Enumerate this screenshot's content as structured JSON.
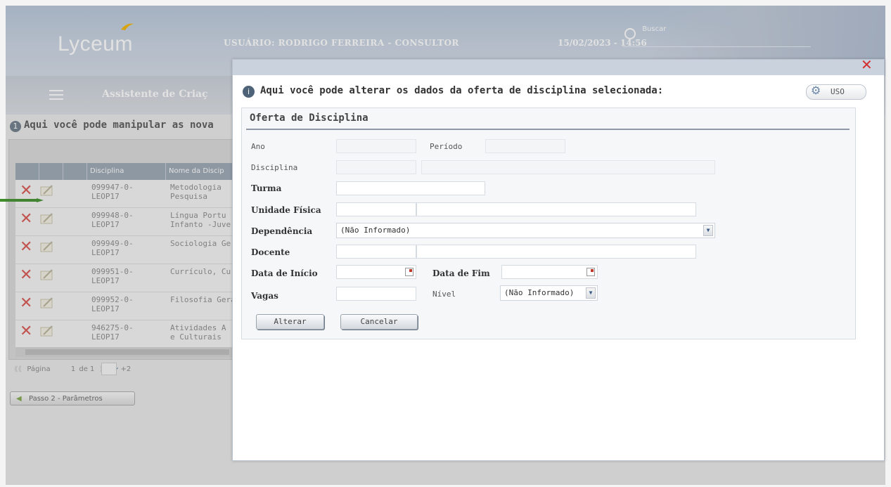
{
  "header": {
    "logo": "Lyceum",
    "user": "USUÁRIO: RODRIGO FERREIRA - CONSULTOR",
    "datetime": "15/02/2023 - 14:56",
    "search_label": "Buscar"
  },
  "nav": {
    "wizard_title": "Assistente de Criaç"
  },
  "background": {
    "info_text": "Aqui você pode manipular as nova",
    "grid_headers": [
      "Disciplina",
      "Nome da Discip"
    ],
    "rows": [
      {
        "code1": "099947-0-",
        "code2": "LEOP17",
        "name1": "Metodologia",
        "name2": "Pesquisa"
      },
      {
        "code1": "099948-0-",
        "code2": "LEOP17",
        "name1": "Língua Portu",
        "name2": "Infanto -Juve"
      },
      {
        "code1": "099949-0-",
        "code2": "LEOP17",
        "name1": "Sociologia Ge",
        "name2": ""
      },
      {
        "code1": "099951-0-",
        "code2": "LEOP17",
        "name1": "Currículo, Cu",
        "name2": ""
      },
      {
        "code1": "099952-0-",
        "code2": "LEOP17",
        "name1": "Filosofia Gera",
        "name2": ""
      },
      {
        "code1": "946275-0-",
        "code2": "LEOP17",
        "name1": "Atividades A",
        "name2": "e Culturais"
      }
    ],
    "pager": {
      "label": "Página",
      "current": "1",
      "of": "de 1",
      "refresh_suffix": "+2"
    },
    "prev_step_button": "Passo 2 - Parâmetros"
  },
  "modal": {
    "close": "✕",
    "title": "Aqui você pode alterar os dados da oferta de disciplina selecionada:",
    "uso_button": "USO",
    "panel_title": "Oferta de Disciplina",
    "labels": {
      "ano": "Ano",
      "periodo": "Período",
      "disciplina": "Disciplina",
      "turma": "Turma",
      "unidade_fisica": "Unidade Física",
      "dependencia": "Dependência",
      "docente": "Docente",
      "data_inicio": "Data de Início",
      "data_fim": "Data de Fim",
      "vagas": "Vagas",
      "nivel": "Nível"
    },
    "dependencia_value": "(Não Informado)",
    "nivel_value": "(Não Informado)",
    "buttons": {
      "alterar": "Alterar",
      "cancelar": "Cancelar"
    }
  },
  "colors": {
    "accent_blue": "#4e6278",
    "close_red": "#d42d2d",
    "delete_red": "#d9534f",
    "arrow_green": "#3e8e2a"
  }
}
